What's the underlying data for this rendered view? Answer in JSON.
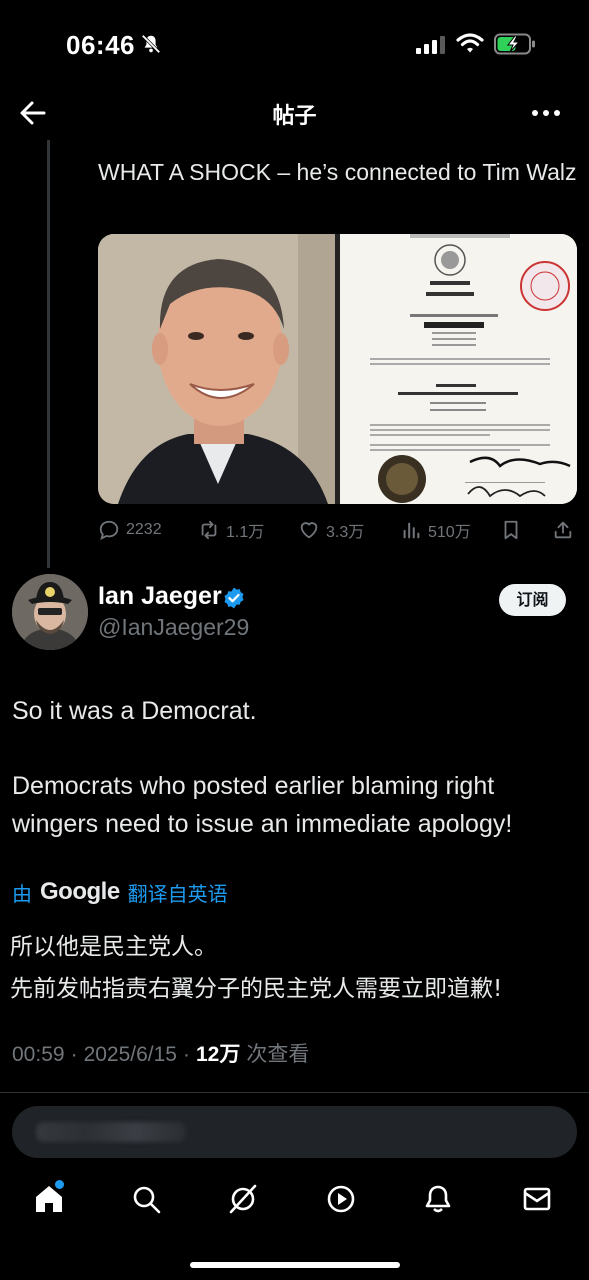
{
  "status_bar": {
    "time": "06:46"
  },
  "nav": {
    "title": "帖子"
  },
  "previous_post": {
    "text": "WHAT A SHOCK – he’s connected to Tim Walz",
    "actions": {
      "replies": "2232",
      "reposts": "1.1万",
      "likes": "3.3万",
      "views": "510万"
    }
  },
  "author": {
    "name": "Ian Jaeger",
    "handle": "@IanJaeger29",
    "subscribe_label": "订阅"
  },
  "post": {
    "paragraph1": "So it was a Democrat.",
    "paragraph2": "Democrats who posted earlier blaming right wingers need to issue an immediate apology!",
    "translate_prefix": "由",
    "translate_brand": "Google",
    "translate_suffix": "翻译自英语",
    "translated_line1": "所以他是民主党人。",
    "translated_line2": "先前发帖指责右翼分子的民主党人需要立即道歉!",
    "time": "00:59",
    "date": "2025/6/15",
    "views_count": "12万",
    "views_label": "次查看"
  },
  "colors": {
    "accent": "#1d9bf0",
    "muted": "#71767b",
    "background": "#000000"
  }
}
